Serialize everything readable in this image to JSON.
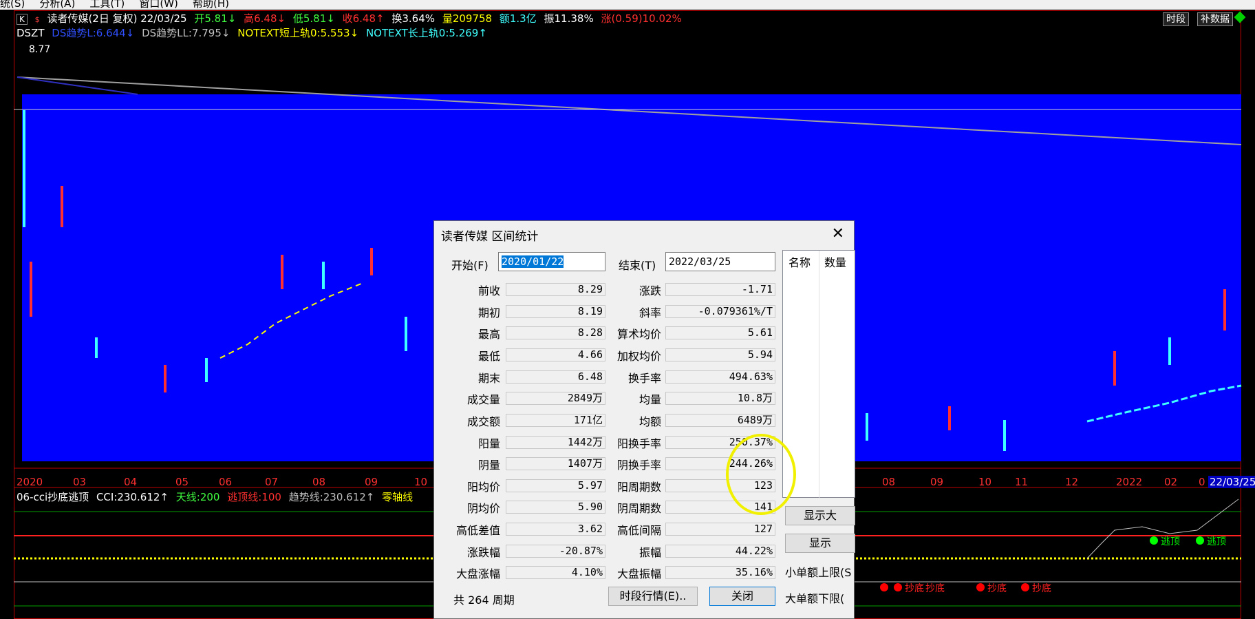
{
  "menu": [
    "统(S)",
    "分析(A)",
    "工具(T)",
    "窗口(W)",
    "帮助(H)"
  ],
  "header": {
    "k_box": "K",
    "dollar": "$",
    "stock_title": "读者传媒(2日 复权) 22/03/25",
    "open": "开5.81↓",
    "high": "高6.48↓",
    "low": "低5.81↓",
    "close": "收6.48↑",
    "turnover": "换3.64%",
    "volume": "量209758",
    "amount": "额1.3亿",
    "amplitude": "振11.38%",
    "change": "涨(0.59)10.02%",
    "btn_period": "时段",
    "btn_supplement": "补数据"
  },
  "indicator_line": {
    "name": "DSZT",
    "ds1": "DS趋势L:6.644↓",
    "ds2": "DS趋势LL:7.795↓",
    "short_rail": "NOTEXT短上轨0:5.553↓",
    "long_rail": "NOTEXT长上轨0:5.269↑"
  },
  "price_top_label": "8.77",
  "x_axis_labels": [
    "2020",
    "03",
    "04",
    "05",
    "06",
    "07",
    "08",
    "09",
    "10",
    "08",
    "09",
    "10",
    "11",
    "12",
    "2022",
    "02",
    "0",
    "22/03/25"
  ],
  "cci_line": {
    "name": "06-cci抄底逃顶",
    "cci": "CCI:230.612↑",
    "sky": "天线:200",
    "top": "逃顶线:100",
    "trend": "趋势线:230.612↑",
    "zero": "零轴线"
  },
  "signals": {
    "escape": [
      "逃顶",
      "逃顶"
    ],
    "bottom": [
      "抄底",
      "抄底",
      "抄底",
      "抄底"
    ]
  },
  "dialog": {
    "title": "读者传媒 区间统计",
    "start_label": "开始(F)",
    "start_value": "2020/01/22",
    "end_label": "结束(T)",
    "end_value": "2022/03/25",
    "rows_left": [
      {
        "label": "前收",
        "value": "8.29"
      },
      {
        "label": "期初",
        "value": "8.19"
      },
      {
        "label": "最高",
        "value": "8.28"
      },
      {
        "label": "最低",
        "value": "4.66"
      },
      {
        "label": "期末",
        "value": "6.48"
      },
      {
        "label": "成交量",
        "value": "2849万"
      },
      {
        "label": "成交额",
        "value": "171亿"
      },
      {
        "label": "阳量",
        "value": "1442万"
      },
      {
        "label": "阴量",
        "value": "1407万"
      },
      {
        "label": "阳均价",
        "value": "5.97"
      },
      {
        "label": "阴均价",
        "value": "5.90"
      },
      {
        "label": "高低差值",
        "value": "3.62"
      },
      {
        "label": "涨跌幅",
        "value": "-20.87%"
      },
      {
        "label": "大盘涨幅",
        "value": "4.10%"
      }
    ],
    "rows_right": [
      {
        "label": "涨跌",
        "value": "-1.71"
      },
      {
        "label": "斜率",
        "value": "-0.079361%/T"
      },
      {
        "label": "算术均价",
        "value": "5.61"
      },
      {
        "label": "加权均价",
        "value": "5.94"
      },
      {
        "label": "换手率",
        "value": "494.63%"
      },
      {
        "label": "均量",
        "value": "10.8万"
      },
      {
        "label": "均额",
        "value": "6489万"
      },
      {
        "label": "阳换手率",
        "value": "250.37%"
      },
      {
        "label": "阴换手率",
        "value": "244.26%"
      },
      {
        "label": "阳周期数",
        "value": "123"
      },
      {
        "label": "阴周期数",
        "value": "141"
      },
      {
        "label": "高低间隔",
        "value": "127"
      },
      {
        "label": "振幅",
        "value": "44.22%"
      },
      {
        "label": "大盘振幅",
        "value": "35.16%"
      }
    ],
    "list_headers": [
      "名称",
      "数量"
    ],
    "btn_show1": "显示大",
    "btn_show2": "显示",
    "small_upper": "小单额上限(S",
    "big_lower": "大单额下限(",
    "period_text": "共 264 周期",
    "btn_period_quote": "时段行情(E)..",
    "btn_close": "关闭"
  }
}
